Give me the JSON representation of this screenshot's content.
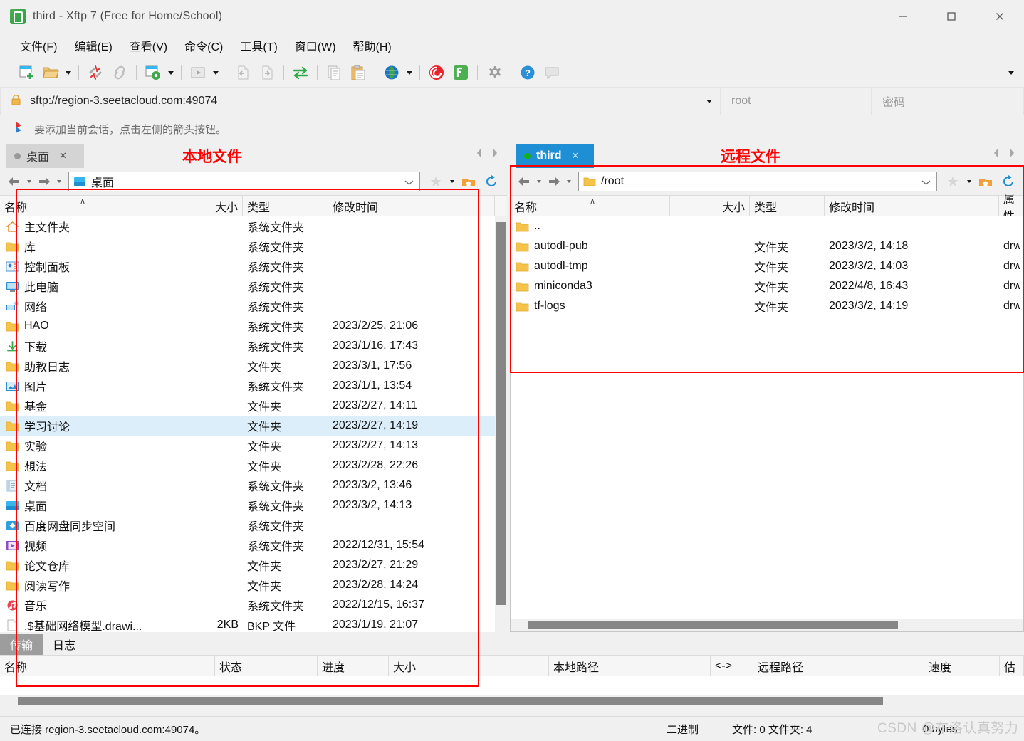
{
  "window": {
    "title": "third - Xftp 7 (Free for Home/School)",
    "minimize_label": "—",
    "maximize_label": "□",
    "close_label": "✕"
  },
  "menu": [
    {
      "label": "文件(F)"
    },
    {
      "label": "编辑(E)"
    },
    {
      "label": "查看(V)"
    },
    {
      "label": "命令(C)"
    },
    {
      "label": "工具(T)"
    },
    {
      "label": "窗口(W)"
    },
    {
      "label": "帮助(H)"
    }
  ],
  "toolbar": {
    "overflow_icon": "chevron-down-icon",
    "buttons": [
      {
        "name": "new-session-icon"
      },
      {
        "name": "open-folder-icon",
        "caret": true
      },
      {
        "name": "disconnect-icon"
      },
      {
        "name": "link-icon"
      },
      {
        "name": "session-properties-icon",
        "caret": true
      },
      {
        "name": "run-icon",
        "caret": true
      },
      {
        "name": "transfer-left-icon"
      },
      {
        "name": "transfer-right-icon"
      },
      {
        "name": "sync-browsing-icon"
      },
      {
        "name": "copy-icon"
      },
      {
        "name": "paste-icon"
      },
      {
        "name": "globe-icon",
        "caret": true
      },
      {
        "name": "xshell-icon"
      },
      {
        "name": "xftp-icon"
      },
      {
        "name": "options-icon"
      },
      {
        "name": "help-icon"
      },
      {
        "name": "feedback-icon"
      }
    ]
  },
  "address": {
    "lock_icon": "lock-icon",
    "url": "sftp://region-3.seetacloud.com:49074",
    "dropdown_icon": "chevron-down-icon",
    "username_placeholder": "root",
    "password_placeholder": "密码"
  },
  "hint": {
    "icon": "flag-icon",
    "text": "要添加当前会话，点击左侧的箭头按钮。"
  },
  "annotations": {
    "local": "本地文件",
    "remote": "远程文件",
    "color": "#ff0000"
  },
  "local_panel": {
    "tab": {
      "label": "桌面",
      "close_label": "✕",
      "status_dot": "inactive"
    },
    "nav": {
      "back_icon": "arrow-left-icon",
      "forward_icon": "arrow-right-icon",
      "favorite_icon": "star-icon",
      "home_icon": "home-folder-icon",
      "refresh_icon": "refresh-icon"
    },
    "path": {
      "icon": "desktop-icon",
      "value": "桌面"
    },
    "columns": [
      {
        "key": "name",
        "label": "名称",
        "align": "left"
      },
      {
        "key": "size",
        "label": "大小",
        "align": "right"
      },
      {
        "key": "type",
        "label": "类型",
        "align": "left"
      },
      {
        "key": "modified",
        "label": "修改时间",
        "align": "left"
      }
    ],
    "sort_indicator": "ascending",
    "rows": [
      {
        "icon": "home-icon",
        "name": "主文件夹",
        "size": "",
        "type": "系统文件夹",
        "modified": ""
      },
      {
        "icon": "folder-icon",
        "name": "库",
        "size": "",
        "type": "系统文件夹",
        "modified": ""
      },
      {
        "icon": "control-panel-icon",
        "name": "控制面板",
        "size": "",
        "type": "系统文件夹",
        "modified": ""
      },
      {
        "icon": "computer-icon",
        "name": "此电脑",
        "size": "",
        "type": "系统文件夹",
        "modified": ""
      },
      {
        "icon": "network-icon",
        "name": "网络",
        "size": "",
        "type": "系统文件夹",
        "modified": ""
      },
      {
        "icon": "folder-icon",
        "name": "HAO",
        "size": "",
        "type": "系统文件夹",
        "modified": "2023/2/25, 21:06"
      },
      {
        "icon": "downloads-icon",
        "name": "下载",
        "size": "",
        "type": "系统文件夹",
        "modified": "2023/1/16, 17:43"
      },
      {
        "icon": "folder-icon",
        "name": "助教日志",
        "size": "",
        "type": "文件夹",
        "modified": "2023/3/1, 17:56"
      },
      {
        "icon": "pictures-icon",
        "name": "图片",
        "size": "",
        "type": "系统文件夹",
        "modified": "2023/1/1, 13:54"
      },
      {
        "icon": "folder-icon",
        "name": "基金",
        "size": "",
        "type": "文件夹",
        "modified": "2023/2/27, 14:11"
      },
      {
        "icon": "folder-icon",
        "name": "学习讨论",
        "size": "",
        "type": "文件夹",
        "modified": "2023/2/27, 14:19",
        "selected": true
      },
      {
        "icon": "folder-icon",
        "name": "实验",
        "size": "",
        "type": "文件夹",
        "modified": "2023/2/27, 14:13"
      },
      {
        "icon": "folder-icon",
        "name": "想法",
        "size": "",
        "type": "文件夹",
        "modified": "2023/2/28, 22:26"
      },
      {
        "icon": "documents-icon",
        "name": "文档",
        "size": "",
        "type": "系统文件夹",
        "modified": "2023/3/2, 13:46"
      },
      {
        "icon": "desktop-icon",
        "name": "桌面",
        "size": "",
        "type": "系统文件夹",
        "modified": "2023/3/2, 14:13"
      },
      {
        "icon": "baidu-icon",
        "name": "百度网盘同步空间",
        "size": "",
        "type": "系统文件夹",
        "modified": ""
      },
      {
        "icon": "videos-icon",
        "name": "视频",
        "size": "",
        "type": "系统文件夹",
        "modified": "2022/12/31, 15:54"
      },
      {
        "icon": "folder-icon",
        "name": "论文仓库",
        "size": "",
        "type": "文件夹",
        "modified": "2023/2/27, 21:29"
      },
      {
        "icon": "folder-icon",
        "name": "阅读写作",
        "size": "",
        "type": "文件夹",
        "modified": "2023/2/28, 14:24"
      },
      {
        "icon": "music-icon",
        "name": "音乐",
        "size": "",
        "type": "系统文件夹",
        "modified": "2022/12/15, 16:37"
      },
      {
        "icon": "file-icon",
        "name": ".$基础网络模型.drawi...",
        "size": "2KB",
        "type": "BKP 文件",
        "modified": "2023/1/19, 21:07"
      }
    ]
  },
  "remote_panel": {
    "tab": {
      "label": "third",
      "close_label": "✕",
      "status_dot": "connected"
    },
    "nav": {
      "back_icon": "arrow-left-icon",
      "forward_icon": "arrow-right-icon",
      "favorite_icon": "star-icon",
      "home_icon": "home-folder-icon",
      "refresh_icon": "refresh-icon"
    },
    "path": {
      "icon": "folder-icon",
      "value": "/root"
    },
    "columns": [
      {
        "key": "name",
        "label": "名称",
        "align": "left"
      },
      {
        "key": "size",
        "label": "大小",
        "align": "right"
      },
      {
        "key": "type",
        "label": "类型",
        "align": "left"
      },
      {
        "key": "modified",
        "label": "修改时间",
        "align": "left"
      },
      {
        "key": "attrs",
        "label": "属性",
        "align": "left"
      }
    ],
    "sort_indicator": "ascending",
    "rows": [
      {
        "icon": "folder-icon",
        "name": "..",
        "size": "",
        "type": "",
        "modified": "",
        "attrs": ""
      },
      {
        "icon": "folder-icon",
        "name": "autodl-pub",
        "size": "",
        "type": "文件夹",
        "modified": "2023/3/2, 14:18",
        "attrs": "drw"
      },
      {
        "icon": "folder-icon",
        "name": "autodl-tmp",
        "size": "",
        "type": "文件夹",
        "modified": "2023/3/2, 14:03",
        "attrs": "drw"
      },
      {
        "icon": "folder-icon",
        "name": "miniconda3",
        "size": "",
        "type": "文件夹",
        "modified": "2022/4/8, 16:43",
        "attrs": "drw"
      },
      {
        "icon": "folder-icon",
        "name": "tf-logs",
        "size": "",
        "type": "文件夹",
        "modified": "2023/3/2, 14:19",
        "attrs": "drw"
      }
    ]
  },
  "transfer_panel": {
    "tabs": [
      {
        "label": "传输",
        "active": true
      },
      {
        "label": "日志",
        "active": false
      }
    ],
    "columns": [
      {
        "label": "名称"
      },
      {
        "label": "状态"
      },
      {
        "label": "进度"
      },
      {
        "label": "大小"
      },
      {
        "label": "本地路径"
      },
      {
        "label": "<->"
      },
      {
        "label": "远程路径"
      },
      {
        "label": "速度"
      },
      {
        "label": "估"
      }
    ],
    "rows": []
  },
  "status_bar": {
    "connection": "已连接 region-3.seetacloud.com:49074。",
    "mode": "二进制",
    "counts": "文件: 0 文件夹: 4",
    "bytes": "0 bytes"
  },
  "watermark": {
    "text": "CSDN @布洛认真努力"
  }
}
